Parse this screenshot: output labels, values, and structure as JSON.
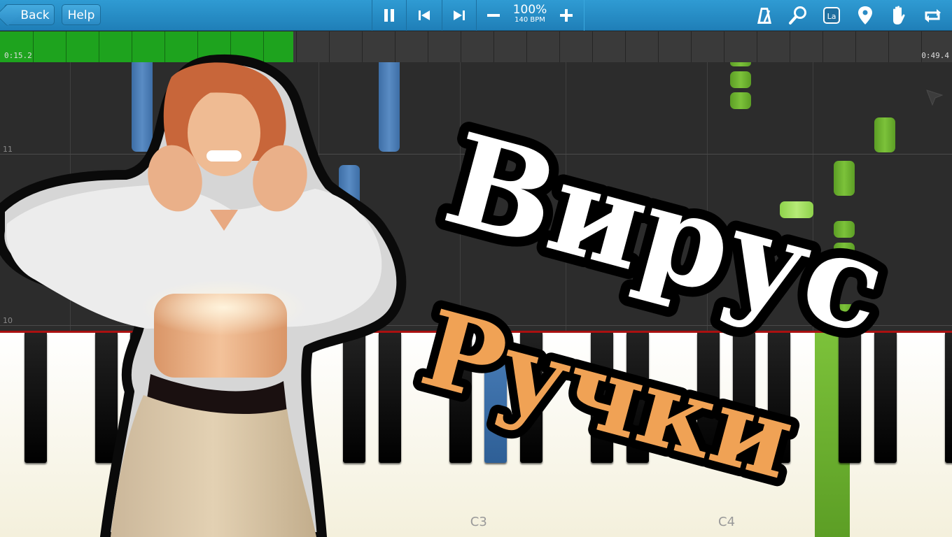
{
  "toolbar": {
    "back_label": "Back",
    "help_label": "Help",
    "zoom_value": "100%",
    "bpm_value": "140 BPM",
    "icons": [
      "pause-icon",
      "skip-back-icon",
      "skip-forward-icon",
      "zoom-out-icon",
      "zoom-in-icon",
      "metronome-icon",
      "search-icon",
      "label-icon",
      "location-pin-icon",
      "hand-icon",
      "loop-icon"
    ],
    "label_icon_text": "La",
    "accent_color": "#2a8ac4"
  },
  "progress": {
    "elapsed": "0:15.2",
    "total": "0:49.4",
    "fraction": 0.308,
    "fill_color": "#1ea31e"
  },
  "roll": {
    "measure_labels": [
      "11",
      "10"
    ],
    "note_colors": {
      "left_hand": "#4a7fba",
      "right_hand": "#6db22c"
    }
  },
  "keyboard": {
    "octave_labels": [
      "C3",
      "C4"
    ]
  },
  "overlay": {
    "title_line1": "Вирус",
    "title_line2": "Ручки",
    "title1_color": "#ffffff",
    "title2_color": "#f0a255"
  }
}
